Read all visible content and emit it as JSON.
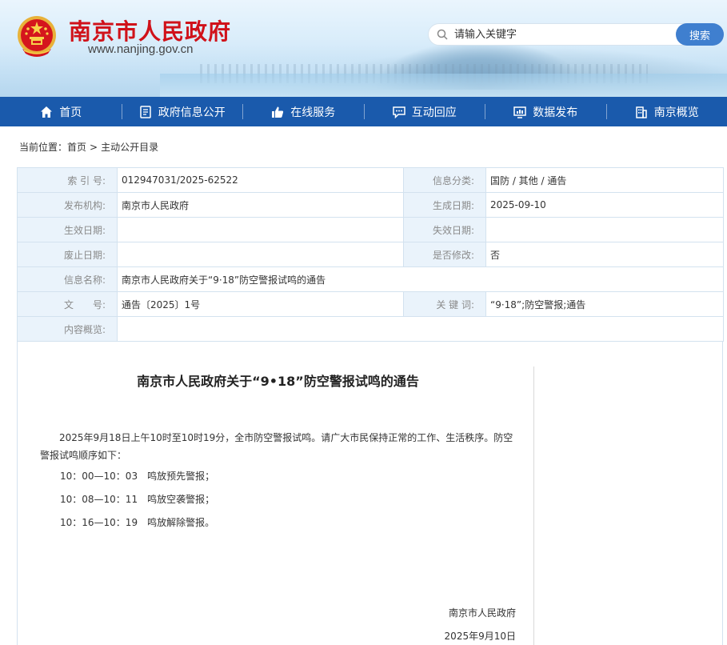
{
  "header": {
    "site_title": "南京市人民政府",
    "site_url": "www.nanjing.gov.cn",
    "search_placeholder": "请输入关键字",
    "search_button": "搜索",
    "colors": {
      "title_red": "#d0121a",
      "nav_blue": "#1a5aac",
      "button_blue": "#3f7fcf"
    }
  },
  "nav": {
    "items": [
      {
        "label": "首页",
        "icon": "home-icon"
      },
      {
        "label": "政府信息公开",
        "icon": "document-icon"
      },
      {
        "label": "在线服务",
        "icon": "thumbs-up-icon"
      },
      {
        "label": "互动回应",
        "icon": "chat-icon"
      },
      {
        "label": "数据发布",
        "icon": "chart-icon"
      },
      {
        "label": "南京概览",
        "icon": "building-icon"
      }
    ]
  },
  "breadcrumb": {
    "prefix": "当前位置：",
    "home": "首页",
    "separator": ">",
    "current": "主动公开目录"
  },
  "info": {
    "index_label": "索 引 号:",
    "index_value": "012947031/2025-62522",
    "category_label": "信息分类:",
    "category_value": "国防 / 其他 / 通告",
    "publisher_label": "发布机构:",
    "publisher_value": "南京市人民政府",
    "created_label": "生成日期:",
    "created_value": "2025-09-10",
    "effective_label": "生效日期:",
    "effective_value": "",
    "expiry_label": "失效日期:",
    "expiry_value": "",
    "abolish_label": "废止日期:",
    "abolish_value": "",
    "modified_label": "是否修改:",
    "modified_value": "否",
    "name_label": "信息名称:",
    "name_value": "南京市人民政府关于“9·18”防空警报试鸣的通告",
    "docno_label": "文　　号:",
    "docno_value": "通告〔2025〕1号",
    "keywords_label": "关 键 词:",
    "keywords_value": "“9·18”;防空警报;通告",
    "summary_label": "内容概览:",
    "summary_value": ""
  },
  "article": {
    "title": "南京市人民政府关于“9•18”防空警报试鸣的通告",
    "paragraph": "2025年9月18日上午10时至10时19分，全市防空警报试鸣。请广大市民保持正常的工作、生活秩序。防空警报试鸣顺序如下：",
    "lines": [
      "10：00—10：03　鸣放预先警报；",
      "10：08—10：11　鸣放空袭警报；",
      "10：16—10：19　鸣放解除警报。"
    ],
    "signature": "南京市人民政府",
    "date": "2025年9月10日"
  }
}
